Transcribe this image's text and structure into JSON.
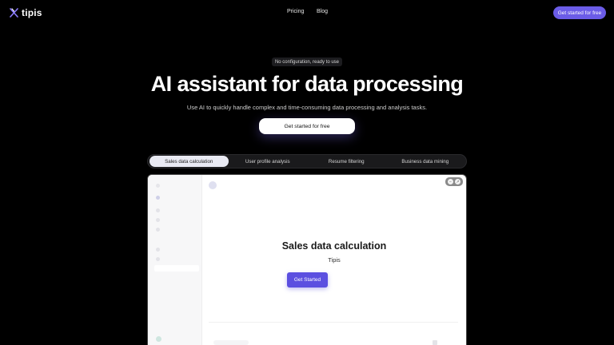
{
  "brand": {
    "name": "tipis",
    "accent": "#6b5ce7"
  },
  "nav": {
    "links": [
      "Pricing",
      "Blog"
    ],
    "cta": "Get started for free"
  },
  "hero": {
    "badge": "No configuration, ready to use",
    "title": "AI assistant for data processing",
    "subtitle": "Use AI to quickly handle complex and time-consuming data processing and analysis tasks.",
    "cta": "Get started for free"
  },
  "tabs": {
    "items": [
      "Sales data calculation",
      "User profile analysis",
      "Resume filtering",
      "Business data mining"
    ],
    "active_index": 0
  },
  "preview": {
    "title": "Sales data calculation",
    "subtitle": "Tipis",
    "cta": "Get Started",
    "window_controls": [
      "minimize-icon",
      "expand-icon"
    ]
  }
}
